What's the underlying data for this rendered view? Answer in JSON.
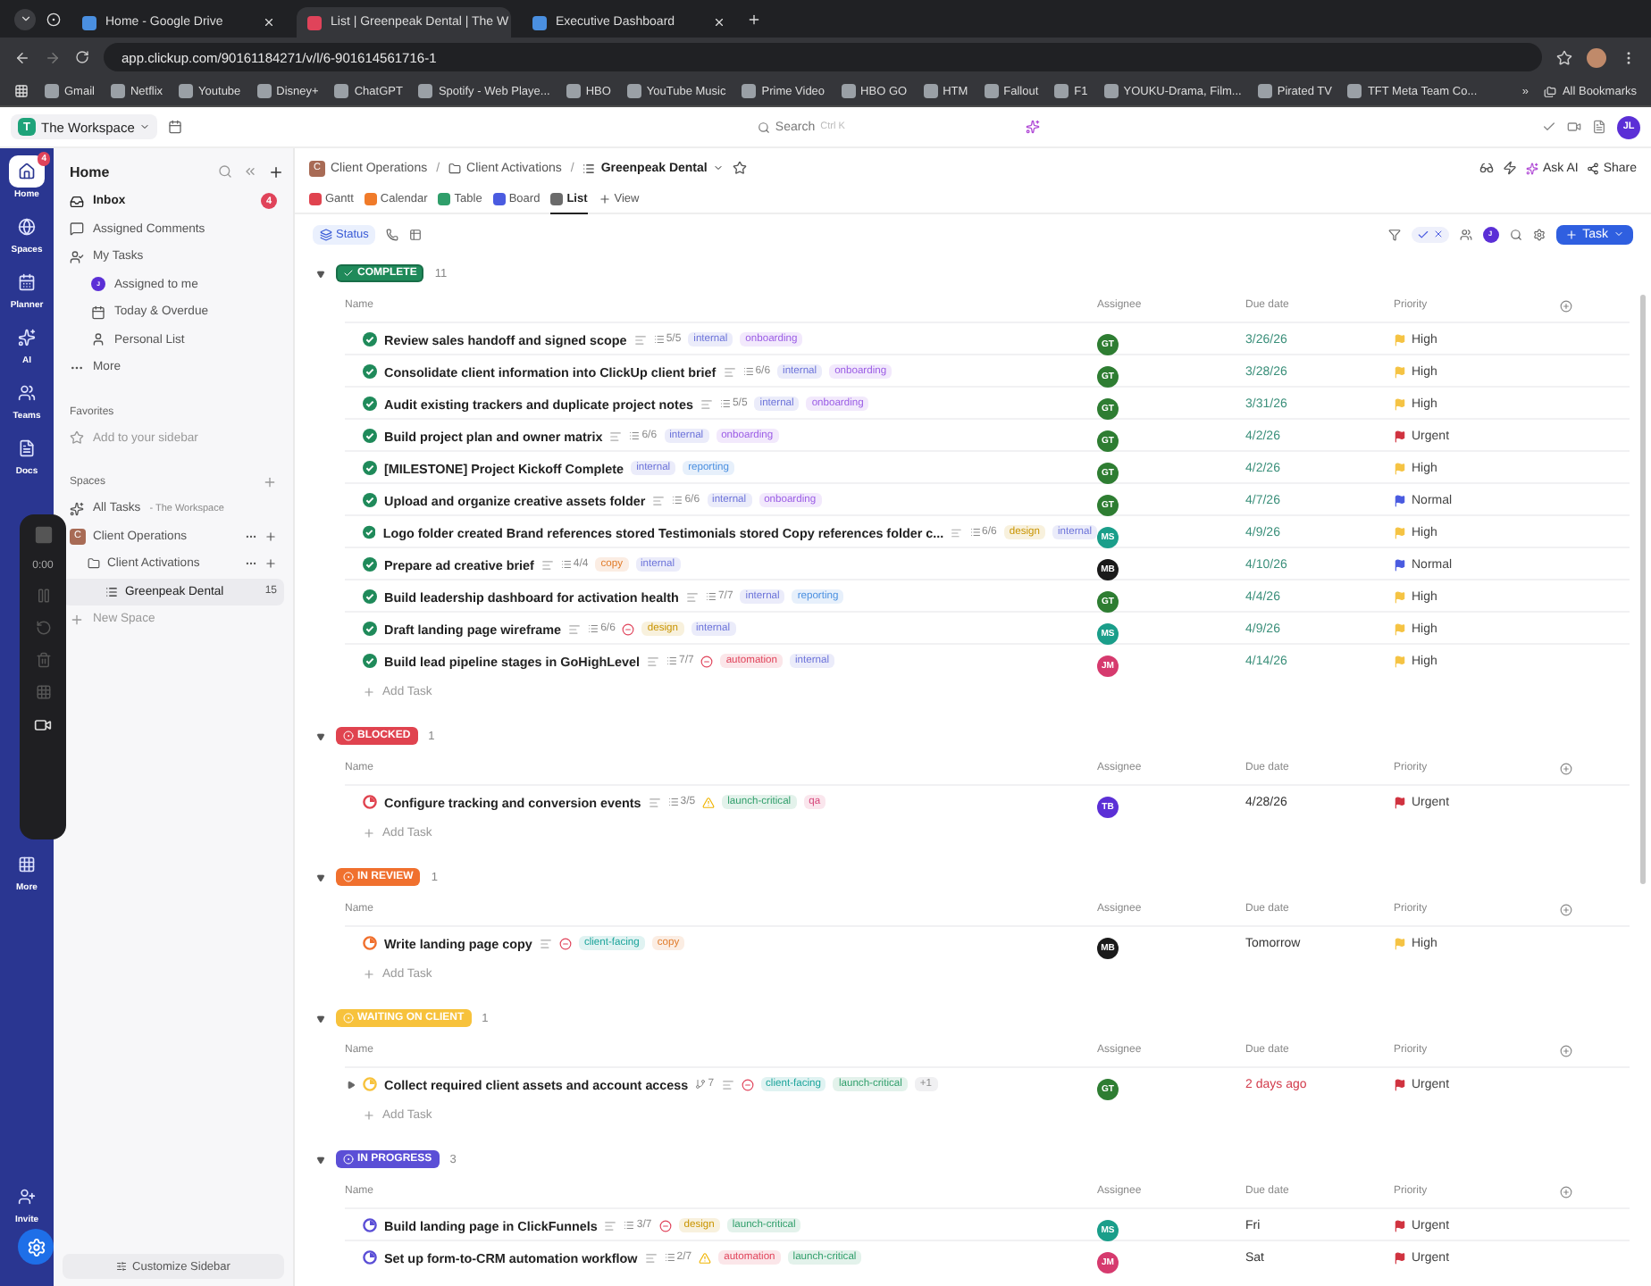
{
  "browser": {
    "tabs": [
      {
        "title": "Home - Google Drive",
        "selected": false
      },
      {
        "title": "List | Greenpeak Dental | The W",
        "selected": true
      },
      {
        "title": "Executive Dashboard",
        "selected": false
      }
    ],
    "url": "app.clickup.com/90161184271/v/l/6-901614561716-1",
    "bookmarks": [
      "Gmail",
      "Netflix",
      "Youtube",
      "Disney+",
      "ChatGPT",
      "Spotify - Web Playe...",
      "HBO",
      "YouTube Music",
      "Prime Video",
      "HBO GO",
      "HTM",
      "Fallout",
      "F1",
      "YOUKU-Drama, Film...",
      "Pirated TV",
      "TFT Meta Team Co..."
    ],
    "more": "»",
    "all_bookmarks": "All Bookmarks"
  },
  "topbar": {
    "workspace": "The Workspace",
    "workspace_initial": "T",
    "search": "Search",
    "shortcut": "Ctrl K",
    "avatar": "JL"
  },
  "rail": {
    "items": [
      {
        "label": "Home",
        "kind": "home",
        "selected": true,
        "badge": "4"
      },
      {
        "label": "Spaces",
        "kind": "spaces",
        "selected": false
      },
      {
        "label": "Planner",
        "kind": "planner",
        "selected": false
      },
      {
        "label": "AI",
        "kind": "ai",
        "selected": false
      },
      {
        "label": "Teams",
        "kind": "teams",
        "selected": false
      },
      {
        "label": "Docs",
        "kind": "docs",
        "selected": false
      }
    ],
    "more": "More",
    "invite": "Invite"
  },
  "recorder": {
    "time": "0:00"
  },
  "sidebar": {
    "title": "Home",
    "nav": [
      {
        "label": "Inbox",
        "kind": "inbox",
        "badge": "4"
      },
      {
        "label": "Assigned Comments",
        "kind": "comments"
      },
      {
        "label": "My Tasks",
        "kind": "tasks"
      },
      {
        "label": "Assigned to me",
        "kind": "assigned",
        "avatar": "J"
      },
      {
        "label": "Today & Overdue",
        "kind": "today"
      },
      {
        "label": "Personal List",
        "kind": "personal"
      },
      {
        "label": "More",
        "kind": "more"
      }
    ],
    "favorites": "Favorites",
    "add_favorite": "Add to your sidebar",
    "spaces": "Spaces",
    "all_tasks": "All Tasks",
    "all_tasks_note": "- The Workspace",
    "tree": [
      {
        "label": "Client Operations",
        "kind": "space",
        "initial": "C",
        "children": [
          {
            "label": "Client Activations",
            "kind": "folder",
            "children": [
              {
                "label": "Greenpeak Dental",
                "kind": "list",
                "count": "15",
                "selected": true
              }
            ]
          }
        ]
      }
    ],
    "new_space": "New Space",
    "customize": "Customize Sidebar"
  },
  "main": {
    "breadcrumb": [
      {
        "label": "Client Operations",
        "kind": "space",
        "initial": "C"
      },
      {
        "label": "Client Activations",
        "kind": "folder"
      },
      {
        "label": "Greenpeak Dental",
        "kind": "list"
      }
    ],
    "separator": "/",
    "actions": [
      "Ask AI",
      "Share"
    ],
    "views": [
      {
        "label": "Gantt",
        "color": "#e0434f",
        "selected": false
      },
      {
        "label": "Calendar",
        "color": "#f07b2a",
        "selected": false
      },
      {
        "label": "Table",
        "color": "#2f9e6a",
        "selected": false
      },
      {
        "label": "Board",
        "color": "#4a5be0",
        "selected": false
      },
      {
        "label": "List",
        "color": "#6b6b6b",
        "selected": true
      }
    ],
    "add_view": "View",
    "group_by": "Status",
    "toolbar_avatar": "J",
    "new_task": "Task"
  },
  "groups": [
    {
      "status": "COMPLETE",
      "color": "#1f8a5a",
      "done": true,
      "count": "11",
      "columns": [
        "Name",
        "Assignee",
        "Due date",
        "Priority"
      ],
      "add": "Add Task",
      "tasks": [
        {
          "name": "Review sales handoff and signed scope",
          "expandable": false,
          "description": true,
          "subtasks": "5/5",
          "blocked": false,
          "at_risk": false,
          "tags": [
            {
              "label": "internal",
              "color": "#6b72d9"
            },
            {
              "label": "onboarding",
              "color": "#9b5de5"
            }
          ],
          "assignee": {
            "initials": "GT",
            "color": "#2e7d32"
          },
          "due": "3/26/26",
          "overdue": false,
          "priority": {
            "label": "High",
            "color": "#f5c343"
          }
        },
        {
          "name": "Consolidate client information into ClickUp client brief",
          "expandable": false,
          "description": true,
          "subtasks": "6/6",
          "blocked": false,
          "at_risk": false,
          "tags": [
            {
              "label": "internal",
              "color": "#6b72d9"
            },
            {
              "label": "onboarding",
              "color": "#9b5de5"
            }
          ],
          "assignee": {
            "initials": "GT",
            "color": "#2e7d32"
          },
          "due": "3/28/26",
          "overdue": false,
          "priority": {
            "label": "High",
            "color": "#f5c343"
          }
        },
        {
          "name": "Audit existing trackers and duplicate project notes",
          "expandable": false,
          "description": true,
          "subtasks": "5/5",
          "blocked": false,
          "at_risk": false,
          "tags": [
            {
              "label": "internal",
              "color": "#6b72d9"
            },
            {
              "label": "onboarding",
              "color": "#9b5de5"
            }
          ],
          "assignee": {
            "initials": "GT",
            "color": "#2e7d32"
          },
          "due": "3/31/26",
          "overdue": false,
          "priority": {
            "label": "High",
            "color": "#f5c343"
          }
        },
        {
          "name": "Build project plan and owner matrix",
          "expandable": false,
          "description": true,
          "subtasks": "6/6",
          "blocked": false,
          "at_risk": false,
          "tags": [
            {
              "label": "internal",
              "color": "#6b72d9"
            },
            {
              "label": "onboarding",
              "color": "#9b5de5"
            }
          ],
          "assignee": {
            "initials": "GT",
            "color": "#2e7d32"
          },
          "due": "4/2/26",
          "overdue": false,
          "priority": {
            "label": "Urgent",
            "color": "#d0323f"
          }
        },
        {
          "name": "[MILESTONE] Project Kickoff Complete",
          "expandable": false,
          "description": false,
          "blocked": false,
          "at_risk": false,
          "tags": [
            {
              "label": "internal",
              "color": "#6b72d9"
            },
            {
              "label": "reporting",
              "color": "#4a8fe0"
            }
          ],
          "assignee": {
            "initials": "GT",
            "color": "#2e7d32"
          },
          "due": "4/2/26",
          "overdue": false,
          "priority": {
            "label": "High",
            "color": "#f5c343"
          }
        },
        {
          "name": "Upload and organize creative assets folder",
          "expandable": false,
          "description": true,
          "subtasks": "6/6",
          "blocked": false,
          "at_risk": false,
          "tags": [
            {
              "label": "internal",
              "color": "#6b72d9"
            },
            {
              "label": "onboarding",
              "color": "#9b5de5"
            }
          ],
          "assignee": {
            "initials": "GT",
            "color": "#2e7d32"
          },
          "due": "4/7/26",
          "overdue": false,
          "priority": {
            "label": "Normal",
            "color": "#4a5be0"
          }
        },
        {
          "name": "Logo folder created Brand references stored Testimonials stored Copy references folder c...",
          "expandable": false,
          "description": true,
          "subtasks": "6/6",
          "blocked": false,
          "at_risk": false,
          "tags": [
            {
              "label": "design",
              "color": "#c99400"
            },
            {
              "label": "internal",
              "color": "#6b72d9"
            }
          ],
          "assignee": {
            "initials": "MS",
            "color": "#1a9e8a"
          },
          "due": "4/9/26",
          "overdue": false,
          "priority": {
            "label": "High",
            "color": "#f5c343"
          }
        },
        {
          "name": "Prepare ad creative brief",
          "expandable": false,
          "description": true,
          "subtasks": "4/4",
          "blocked": false,
          "at_risk": false,
          "tags": [
            {
              "label": "copy",
              "color": "#e07b2a"
            },
            {
              "label": "internal",
              "color": "#6b72d9"
            }
          ],
          "assignee": {
            "initials": "MB",
            "color": "#1a1a1a"
          },
          "due": "4/10/26",
          "overdue": false,
          "priority": {
            "label": "Normal",
            "color": "#4a5be0"
          }
        },
        {
          "name": "Build leadership dashboard for activation health",
          "expandable": false,
          "description": true,
          "subtasks": "7/7",
          "blocked": false,
          "at_risk": false,
          "tags": [
            {
              "label": "internal",
              "color": "#6b72d9"
            },
            {
              "label": "reporting",
              "color": "#4a8fe0"
            }
          ],
          "assignee": {
            "initials": "GT",
            "color": "#2e7d32"
          },
          "due": "4/4/26",
          "overdue": false,
          "priority": {
            "label": "High",
            "color": "#f5c343"
          }
        },
        {
          "name": "Draft landing page wireframe",
          "expandable": false,
          "description": true,
          "subtasks": "6/6",
          "blocked": true,
          "at_risk": false,
          "tags": [
            {
              "label": "design",
              "color": "#c99400"
            },
            {
              "label": "internal",
              "color": "#6b72d9"
            }
          ],
          "assignee": {
            "initials": "MS",
            "color": "#1a9e8a"
          },
          "due": "4/9/26",
          "overdue": false,
          "priority": {
            "label": "High",
            "color": "#f5c343"
          }
        },
        {
          "name": "Build lead pipeline stages in GoHighLevel",
          "expandable": false,
          "description": true,
          "subtasks": "7/7",
          "blocked": true,
          "at_risk": false,
          "tags": [
            {
              "label": "automation",
              "color": "#e0435a"
            },
            {
              "label": "internal",
              "color": "#6b72d9"
            }
          ],
          "assignee": {
            "initials": "JM",
            "color": "#d63a6e"
          },
          "due": "4/14/26",
          "overdue": false,
          "priority": {
            "label": "High",
            "color": "#f5c343"
          }
        }
      ]
    },
    {
      "status": "BLOCKED",
      "color": "#e0434f",
      "done": false,
      "count": "1",
      "columns": [
        "Name",
        "Assignee",
        "Due date",
        "Priority"
      ],
      "add": "Add Task",
      "tasks": [
        {
          "name": "Configure tracking and conversion events",
          "expandable": false,
          "description": true,
          "subtasks": "3/5",
          "blocked": false,
          "at_risk": true,
          "tags": [
            {
              "label": "launch-critical",
              "color": "#2f9e6a"
            },
            {
              "label": "qa",
              "color": "#d6457a"
            }
          ],
          "assignee": {
            "initials": "TB",
            "color": "#5b2fd6"
          },
          "due": "4/28/26",
          "overdue": false,
          "priority": {
            "label": "Urgent",
            "color": "#d0323f"
          }
        }
      ]
    },
    {
      "status": "IN REVIEW",
      "color": "#f0702e",
      "done": false,
      "count": "1",
      "columns": [
        "Name",
        "Assignee",
        "Due date",
        "Priority"
      ],
      "add": "Add Task",
      "tasks": [
        {
          "name": "Write landing page copy",
          "expandable": false,
          "description": true,
          "blocked": true,
          "at_risk": false,
          "tags": [
            {
              "label": "client-facing",
              "color": "#1aa39a"
            },
            {
              "label": "copy",
              "color": "#e07b2a"
            }
          ],
          "assignee": {
            "initials": "MB",
            "color": "#1a1a1a"
          },
          "due": "Tomorrow",
          "overdue": false,
          "priority": {
            "label": "High",
            "color": "#f5c343"
          }
        }
      ]
    },
    {
      "status": "WAITING ON CLIENT",
      "color": "#f7c23c",
      "done": false,
      "count": "1",
      "columns": [
        "Name",
        "Assignee",
        "Due date",
        "Priority"
      ],
      "add": "Add Task",
      "tasks": [
        {
          "name": "Collect required client assets and account access",
          "expandable": true,
          "branches": "7",
          "description": true,
          "blocked": true,
          "at_risk": false,
          "tags": [
            {
              "label": "client-facing",
              "color": "#1aa39a"
            },
            {
              "label": "launch-critical",
              "color": "#2f9e6a"
            }
          ],
          "more_tags": "+1",
          "assignee": {
            "initials": "GT",
            "color": "#2e7d32"
          },
          "due": "2 days ago",
          "overdue": true,
          "priority": {
            "label": "Urgent",
            "color": "#d0323f"
          }
        }
      ]
    },
    {
      "status": "IN PROGRESS",
      "color": "#5b4fd6",
      "done": false,
      "count": "3",
      "columns": [
        "Name",
        "Assignee",
        "Due date",
        "Priority"
      ],
      "tasks": [
        {
          "name": "Build landing page in ClickFunnels",
          "expandable": false,
          "description": true,
          "subtasks": "3/7",
          "blocked": true,
          "at_risk": false,
          "tags": [
            {
              "label": "design",
              "color": "#c99400"
            },
            {
              "label": "launch-critical",
              "color": "#2f9e6a"
            }
          ],
          "assignee": {
            "initials": "MS",
            "color": "#1a9e8a"
          },
          "due": "Fri",
          "overdue": false,
          "priority": {
            "label": "Urgent",
            "color": "#d0323f"
          }
        },
        {
          "name": "Set up form-to-CRM automation workflow",
          "expandable": false,
          "description": true,
          "subtasks": "2/7",
          "blocked": false,
          "at_risk": true,
          "tags": [
            {
              "label": "automation",
              "color": "#e0435a"
            },
            {
              "label": "launch-critical",
              "color": "#2f9e6a"
            }
          ],
          "assignee": {
            "initials": "JM",
            "color": "#d63a6e"
          },
          "due": "Sat",
          "overdue": false,
          "priority": {
            "label": "Urgent",
            "color": "#d0323f"
          }
        }
      ]
    }
  ]
}
